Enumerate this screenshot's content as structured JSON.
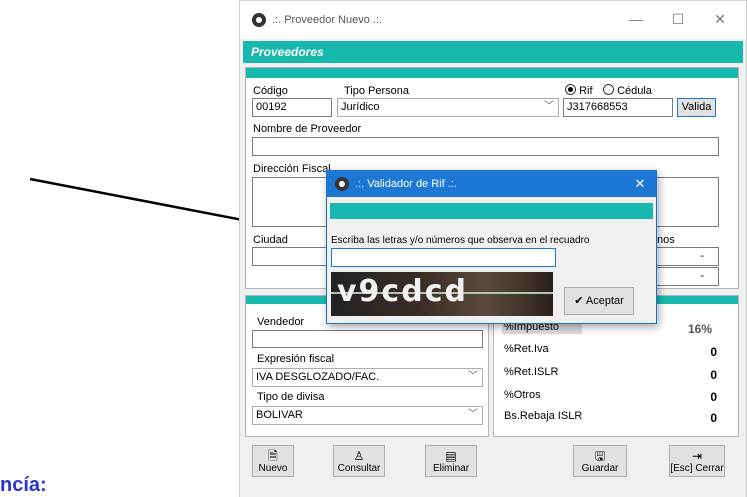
{
  "main_window": {
    "title": ".:. Proveedor Nuevo .:.",
    "controls": {
      "minimize": "—",
      "maximize": "☐",
      "close": "✕"
    },
    "banner": "Proveedores"
  },
  "form": {
    "codigo_label": "Código",
    "codigo_value": "00192",
    "tipo_persona_label": "Tipo Persona",
    "tipo_persona_value": "Jurídico",
    "rif_radio_label": "Rif",
    "cedula_radio_label": "Cédula",
    "rif_value": "J317668553",
    "valida_button": "Valida",
    "nombre_label": "Nombre de Proveedor",
    "direccion_label": "Dirección Fiscal",
    "ciudad_label": "Ciudad",
    "telefonos_label_fragment": "nos",
    "phone_fields": [
      "-",
      "-"
    ]
  },
  "lower_left": {
    "vendedor_label": "Vendedor",
    "expresion_label": "Expresión fiscal",
    "expresion_value": "IVA DESGLOZADO/FAC.",
    "divisa_label": "Tipo de divisa",
    "divisa_value": "BOLIVAR"
  },
  "lower_right": {
    "rows": [
      {
        "label": "%Impuesto",
        "value": "16%"
      },
      {
        "label": "%Ret.Iva",
        "value": "0"
      },
      {
        "label": "%Ret.ISLR",
        "value": "0"
      },
      {
        "label": "%Otros",
        "value": "0"
      },
      {
        "label": "Bs.Rebaja ISLR",
        "value": "0"
      }
    ]
  },
  "toolbar": {
    "nuevo": "Nuevo",
    "consultar": "Consultar",
    "eliminar": "Eliminar",
    "guardar": "Guardar",
    "cerrar": "[Esc] Cerrar"
  },
  "dialog": {
    "title": ".:. Validador de Rif .:.",
    "close": "✕",
    "instruction": "Escriba las letras y/o números que observa en el recuadro",
    "input_value": "",
    "captcha_text": "v9cdcd",
    "aceptar": "Aceptar"
  },
  "footer_fragment": "ncía:",
  "colors": {
    "accent": "#18b9ad",
    "dialog_title": "#1b78d4"
  }
}
